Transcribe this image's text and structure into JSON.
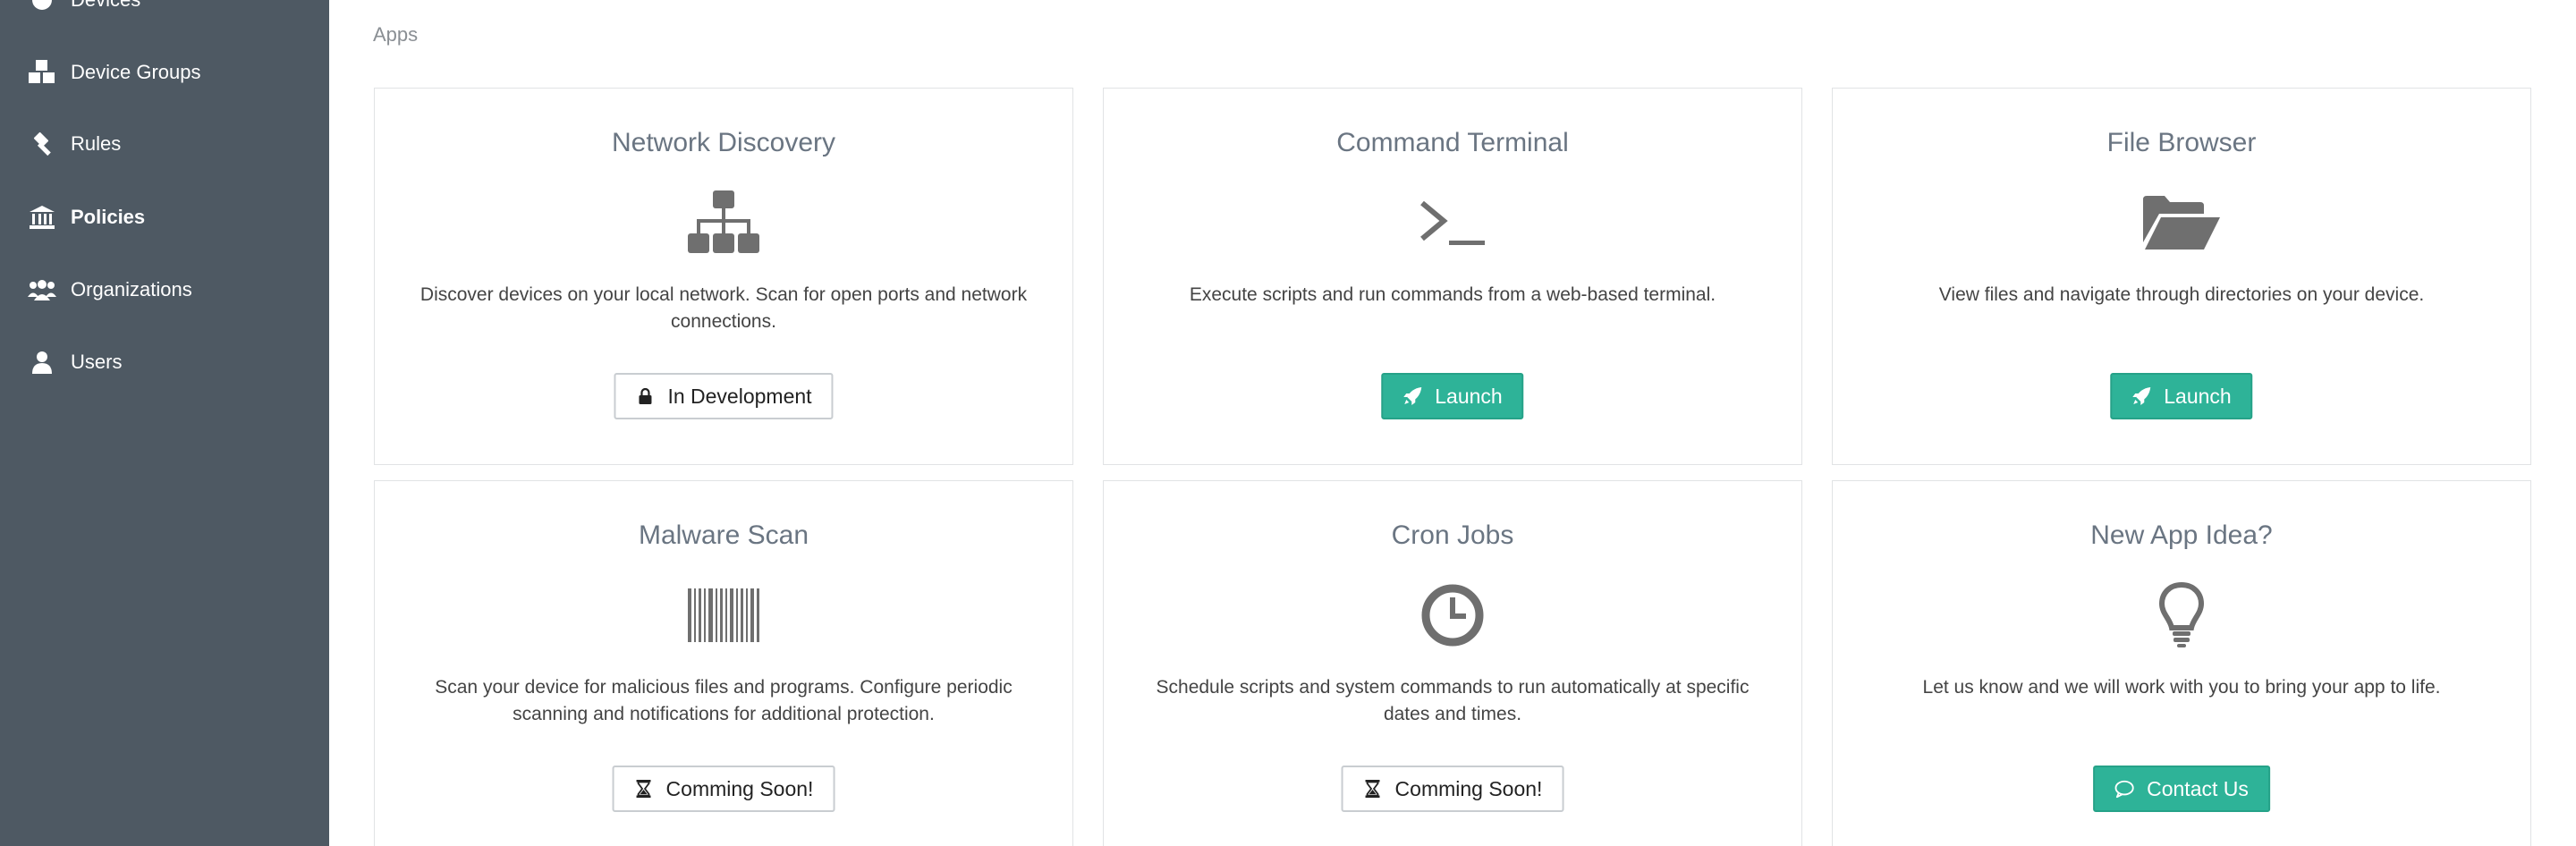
{
  "sidebar": {
    "items": [
      {
        "label": "Devices",
        "icon": "devices-icon"
      },
      {
        "label": "Device Groups",
        "icon": "cubes-icon"
      },
      {
        "label": "Rules",
        "icon": "gavel-icon"
      },
      {
        "label": "Policies",
        "icon": "bank-icon",
        "active": true
      },
      {
        "label": "Organizations",
        "icon": "users-group-icon"
      },
      {
        "label": "Users",
        "icon": "user-icon"
      }
    ]
  },
  "main": {
    "heading": "Apps",
    "cards": [
      {
        "title": "Network Discovery",
        "icon": "sitemap-icon",
        "description": "Discover devices on your local network. Scan for open ports and network connections.",
        "button": {
          "label": "In Development",
          "icon": "lock-icon",
          "style": "outline"
        }
      },
      {
        "title": "Command Terminal",
        "icon": "terminal-icon",
        "description": "Execute scripts and run commands from a web-based terminal.",
        "button": {
          "label": "Launch",
          "icon": "rocket-icon",
          "style": "primary"
        }
      },
      {
        "title": "File Browser",
        "icon": "folder-open-icon",
        "description": "View files and navigate through directories on your device.",
        "button": {
          "label": "Launch",
          "icon": "rocket-icon",
          "style": "primary"
        }
      },
      {
        "title": "Malware Scan",
        "icon": "barcode-icon",
        "description": "Scan your device for malicious files and programs. Configure periodic scanning and notifications for additional protection.",
        "button": {
          "label": "Comming Soon!",
          "icon": "hourglass-icon",
          "style": "outline"
        }
      },
      {
        "title": "Cron Jobs",
        "icon": "clock-icon",
        "description": "Schedule scripts and system commands to run automatically at specific dates and times.",
        "button": {
          "label": "Comming Soon!",
          "icon": "hourglass-icon",
          "style": "outline"
        }
      },
      {
        "title": "New App Idea?",
        "icon": "lightbulb-icon",
        "description": "Let us know and we will work with you to bring your app to life.",
        "button": {
          "label": "Contact Us",
          "icon": "comment-icon",
          "style": "primary"
        }
      }
    ]
  },
  "colors": {
    "sidebar_bg": "#4e5963",
    "primary": "#2eb398",
    "icon_gray": "#6f6f6f"
  }
}
